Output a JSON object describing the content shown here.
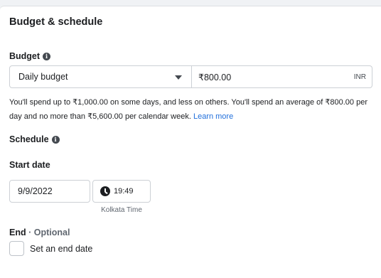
{
  "section": {
    "title": "Budget & schedule"
  },
  "budget": {
    "label": "Budget",
    "info_icon": "info-icon",
    "type_selected": "Daily budget",
    "amount": "₹800.00",
    "currency": "INR",
    "help_text": "You'll spend up to ₹1,000.00 on some days, and less on others. You'll spend an average of ₹800.00 per day and no more than ₹5,600.00 per calendar week.",
    "learn_more": "Learn more"
  },
  "schedule": {
    "label": "Schedule",
    "info_icon": "info-icon",
    "start_label": "Start date",
    "start_date": "9/9/2022",
    "start_time": "19:49",
    "timezone": "Kolkata Time",
    "end_label": "End",
    "end_optional": "· Optional",
    "end_checkbox_label": "Set an end date"
  },
  "colors": {
    "link": "#216fdb",
    "border": "#ccd0d5",
    "muted": "#606770"
  }
}
